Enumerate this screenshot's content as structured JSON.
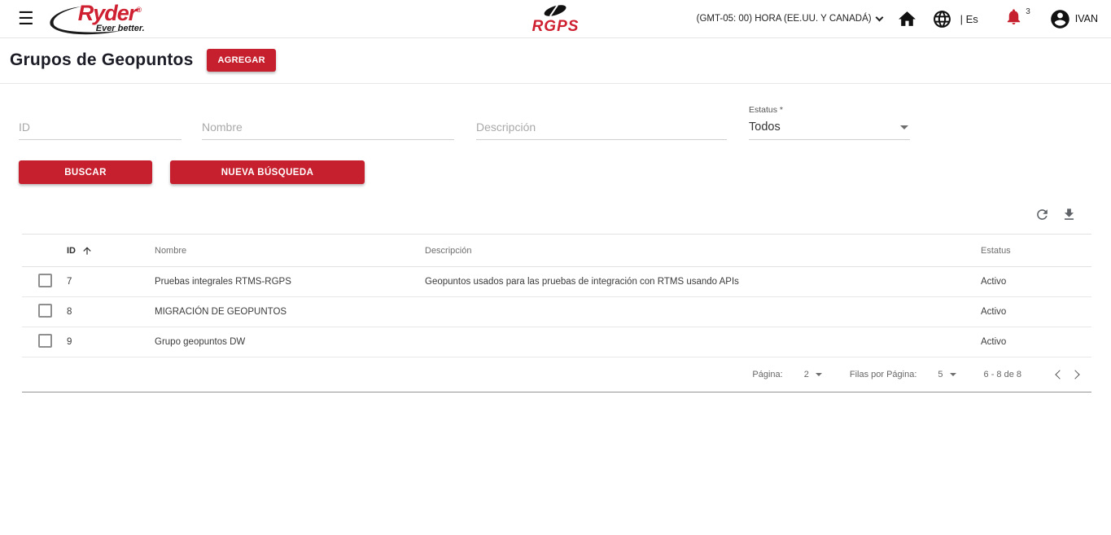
{
  "topbar": {
    "brand_name": "Ryder",
    "brand_tagline": "Ever better.",
    "app_name": "RGPS",
    "timezone": "(GMT-05: 00) HORA (EE.UU. Y CANADÁ)",
    "language_label": "| Es",
    "notifications_count": "3",
    "username": "IVAN"
  },
  "page": {
    "title": "Grupos de Geopuntos",
    "add_button": "AGREGAR"
  },
  "filters": {
    "id_placeholder": "ID",
    "nombre_placeholder": "Nombre",
    "descripcion_placeholder": "Descripción",
    "estatus_label": "Estatus *",
    "estatus_value": "Todos",
    "buscar_button": "BUSCAR",
    "nueva_busqueda_button": "NUEVA BÚSQUEDA"
  },
  "table": {
    "columns": {
      "id": "ID",
      "nombre": "Nombre",
      "descripcion": "Descripción",
      "estatus": "Estatus"
    },
    "rows": [
      {
        "id": "7",
        "nombre": "Pruebas integrales RTMS-RGPS",
        "descripcion": "Geopuntos usados para las pruebas de integración con RTMS usando APIs",
        "estatus": "Activo"
      },
      {
        "id": "8",
        "nombre": "MIGRACIÓN DE GEOPUNTOS",
        "descripcion": "",
        "estatus": "Activo"
      },
      {
        "id": "9",
        "nombre": "Grupo geopuntos DW",
        "descripcion": "",
        "estatus": "Activo"
      }
    ],
    "pagination": {
      "page_label": "Página:",
      "page_value": "2",
      "rows_label": "Filas por Página:",
      "rows_value": "5",
      "range": "6 - 8 de 8"
    }
  },
  "colors": {
    "accent_red": "#c6202e",
    "icon_black": "#111111",
    "icon_gray": "#5f6368"
  }
}
